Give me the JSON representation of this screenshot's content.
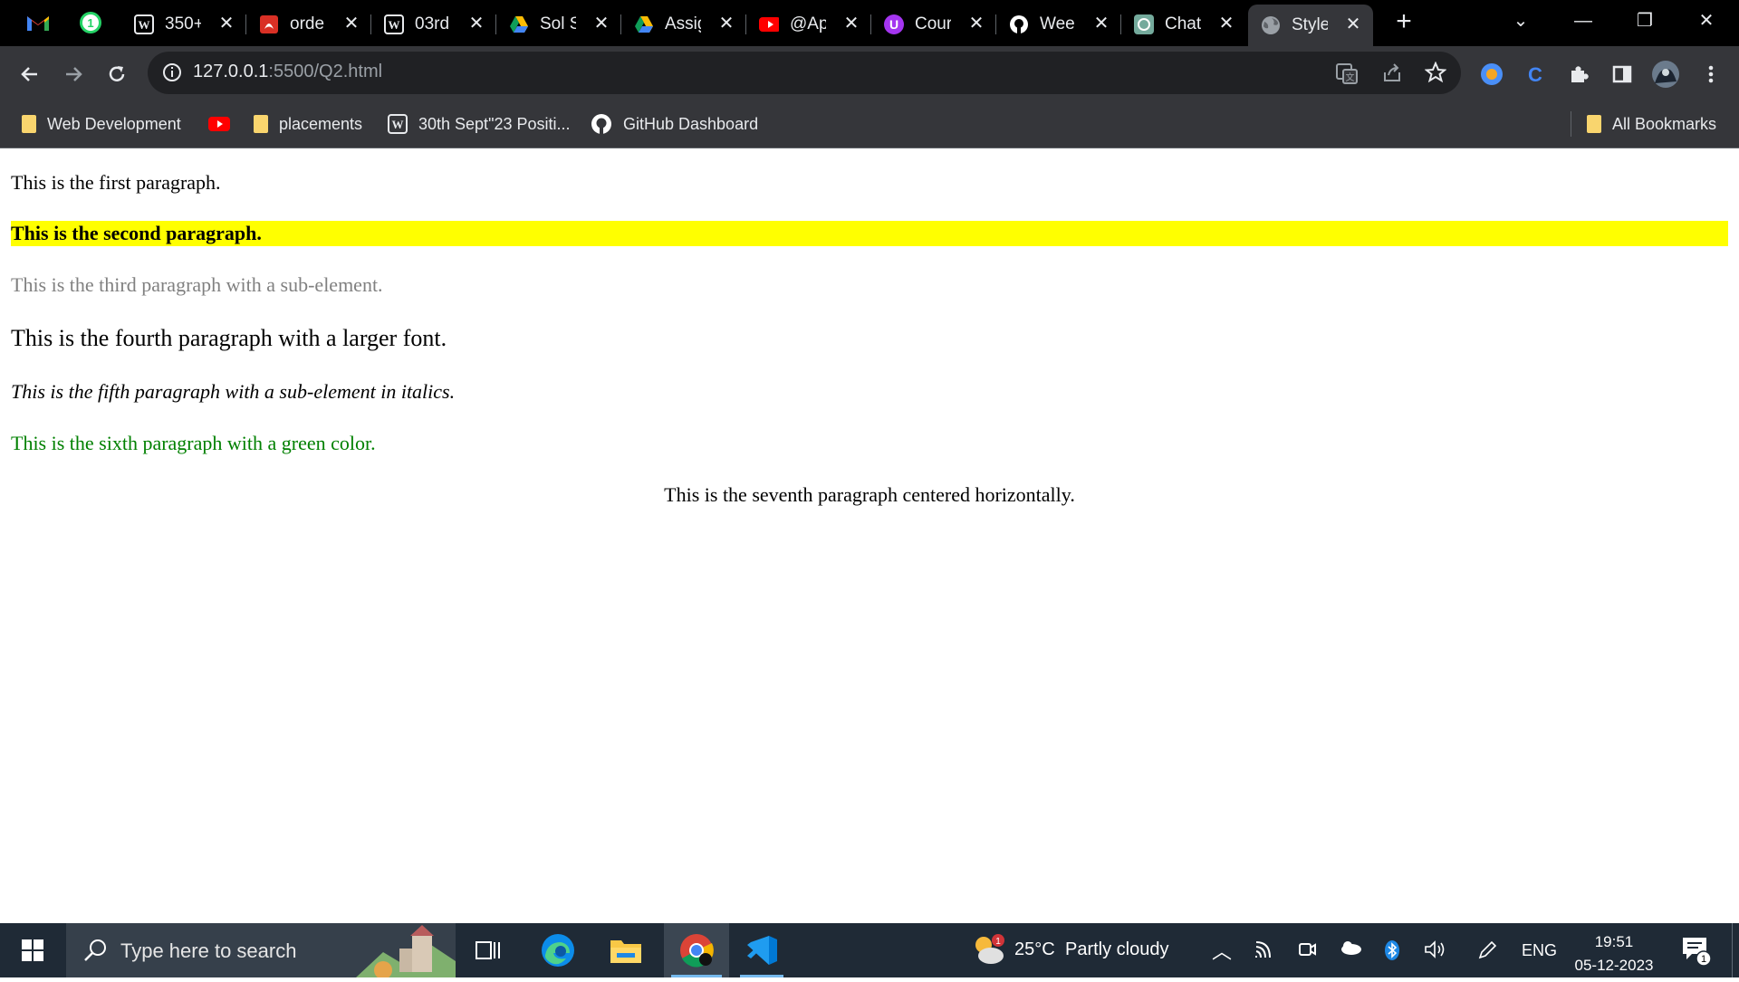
{
  "browser": {
    "tabs": [
      {
        "title": "350+",
        "icon": "wordpress-icon"
      },
      {
        "title": "orde",
        "icon": "pdf-icon"
      },
      {
        "title": "03rd",
        "icon": "wordpress-icon"
      },
      {
        "title": "Sol S",
        "icon": "google-drive-icon"
      },
      {
        "title": "Assig",
        "icon": "google-drive-icon"
      },
      {
        "title": "@Ap",
        "icon": "youtube-icon"
      },
      {
        "title": "Cour",
        "icon": "udemy-icon"
      },
      {
        "title": "Wee",
        "icon": "github-icon"
      },
      {
        "title": "Chat",
        "icon": "chatgpt-icon"
      },
      {
        "title": "Style",
        "icon": "globe-icon"
      }
    ],
    "pinned": [
      "gmail-icon",
      "whatsapp-icon"
    ],
    "whatsapp_badge": "1",
    "url_host": "127.0.0.1",
    "url_rest": ":5500/Q2.html",
    "bookmarks": [
      {
        "label": "Web Development"
      },
      {
        "label": "placements"
      },
      {
        "label": "30th Sept\"23 Positi..."
      },
      {
        "label": "GitHub Dashboard"
      }
    ],
    "all_bookmarks": "All Bookmarks"
  },
  "page": {
    "p1": "This is the first paragraph.",
    "p2": "This is the second paragraph.",
    "p3": "This is the third paragraph with a sub-element.",
    "p4": "This is the fourth paragraph with a larger font.",
    "p5": "This is the fifth paragraph with a sub-element in italics.",
    "p6": "This is the sixth paragraph with a green color.",
    "p7": "This is the seventh paragraph centered horizontally."
  },
  "taskbar": {
    "search_placeholder": "Type here to search",
    "weather_temp": "25°C",
    "weather_desc": "Partly cloudy",
    "weather_badge": "1",
    "language": "ENG",
    "time": "19:51",
    "date": "05-12-2023",
    "notification_count": "1"
  },
  "colors": {
    "highlight": "#ffff00",
    "grey_text": "#808080",
    "green_text": "#008000"
  }
}
